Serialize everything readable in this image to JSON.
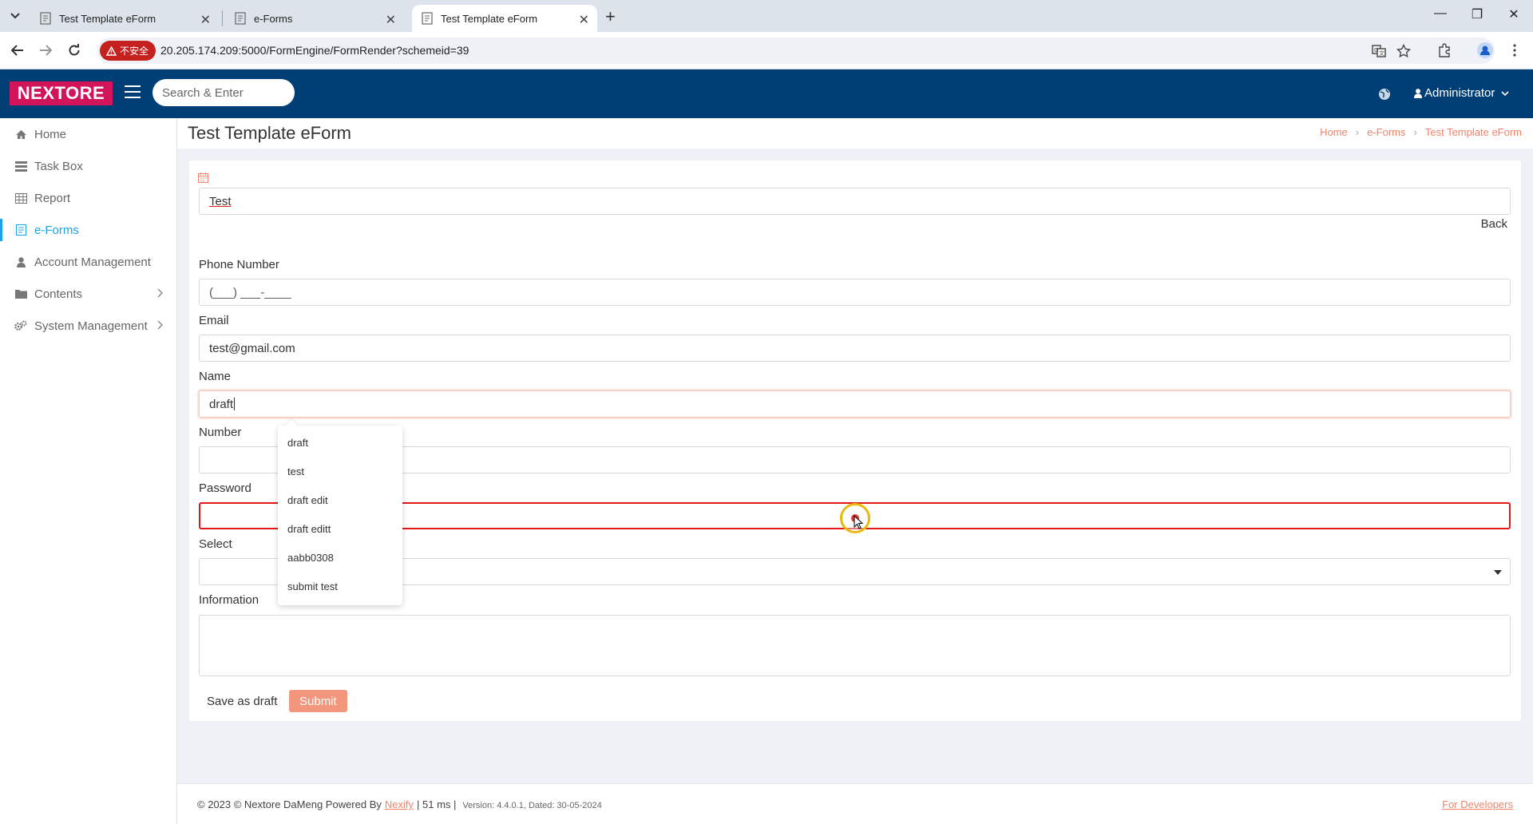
{
  "browser": {
    "tabs": [
      {
        "title": "Test Template eForm",
        "active": false
      },
      {
        "title": "e-Forms",
        "active": false
      },
      {
        "title": "Test Template eForm",
        "active": true
      }
    ],
    "insecure_label": "不安全",
    "url": "20.205.174.209:5000/FormEngine/FormRender?schemeid=39"
  },
  "header": {
    "logo": "NEXTORE",
    "search_placeholder": "Search & Enter",
    "user": "Administrator"
  },
  "sidebar": {
    "items": [
      {
        "label": "Home",
        "icon": "home-icon",
        "active": false
      },
      {
        "label": "Task Box",
        "icon": "task-box-icon",
        "active": false
      },
      {
        "label": "Report",
        "icon": "table-icon",
        "active": false
      },
      {
        "label": "e-Forms",
        "icon": "form-icon",
        "active": true
      },
      {
        "label": "Account Management",
        "icon": "user-icon",
        "active": false
      },
      {
        "label": "Contents",
        "icon": "folder-icon",
        "active": false,
        "expandable": true
      },
      {
        "label": "System Management",
        "icon": "gears-icon",
        "active": false,
        "expandable": true
      }
    ]
  },
  "page": {
    "title": "Test Template eForm",
    "breadcrumb": [
      "Home",
      "e-Forms",
      "Test Template eForm"
    ]
  },
  "form": {
    "title_value": "Test",
    "back_label": "Back",
    "fields": {
      "phone": {
        "label": "Phone Number",
        "value": "(___) ___-____"
      },
      "email": {
        "label": "Email",
        "value": "test@gmail.com"
      },
      "name": {
        "label": "Name",
        "value": "draft"
      },
      "number": {
        "label": "Number",
        "value": ""
      },
      "password": {
        "label": "Password",
        "value": ""
      },
      "select": {
        "label": "Select",
        "value": ""
      },
      "information": {
        "label": "Information",
        "value": ""
      }
    },
    "autocomplete": [
      "draft",
      "test",
      "draft edit",
      "draft editt",
      "aabb0308",
      "submit test"
    ],
    "save_draft_label": "Save as draft",
    "submit_label": "Submit"
  },
  "footer": {
    "copyright": "© 2023 © Nextore DaMeng Powered By",
    "powered_link": "Nexify",
    "timing": "| 51 ms |",
    "version": "Version: 4.4.0.1, Dated: 30-05-2024",
    "developers": "For Developers"
  },
  "colors": {
    "header_bg": "#003f75",
    "logo_bg": "#d2145a",
    "accent": "#f2836b",
    "active_nav": "#1aa4e8",
    "submit_bg": "#f2967e",
    "highlight_border": "#e01818"
  }
}
